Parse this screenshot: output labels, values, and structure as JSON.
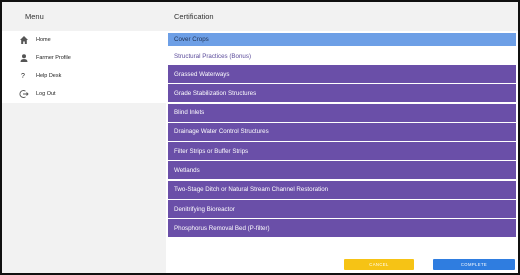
{
  "menu": {
    "title": "Menu",
    "items": [
      {
        "label": "Home",
        "icon": "home-icon"
      },
      {
        "label": "Farmer Profile",
        "icon": "person-icon"
      },
      {
        "label": "Help Desk",
        "icon": "help-icon"
      },
      {
        "label": "Log Out",
        "icon": "logout-icon"
      }
    ]
  },
  "certification": {
    "title": "Certification",
    "selected_item": "Cover Crops",
    "section_label": "Structural Practices (Bonus)",
    "practices": [
      "Grassed Waterways",
      "Grade Stabilization Structures",
      "Blind Inlets",
      "Drainage Water Control Structures",
      "Filter Strips or Buffer Strips",
      "Wetlands",
      "Two-Stage Ditch or Natural Stream Channel Restoration",
      "Denitrifying Bioreactor",
      "Phosphorus Removal Bed (P-filter)"
    ]
  },
  "footer": {
    "cancel_label": "CANCEL",
    "complete_label": "COMPLETE"
  },
  "colors": {
    "practice_row": "#6a4fa8",
    "selected_row": "#6d9fe6",
    "cancel_button": "#f6c315",
    "complete_button": "#2f7de0"
  }
}
